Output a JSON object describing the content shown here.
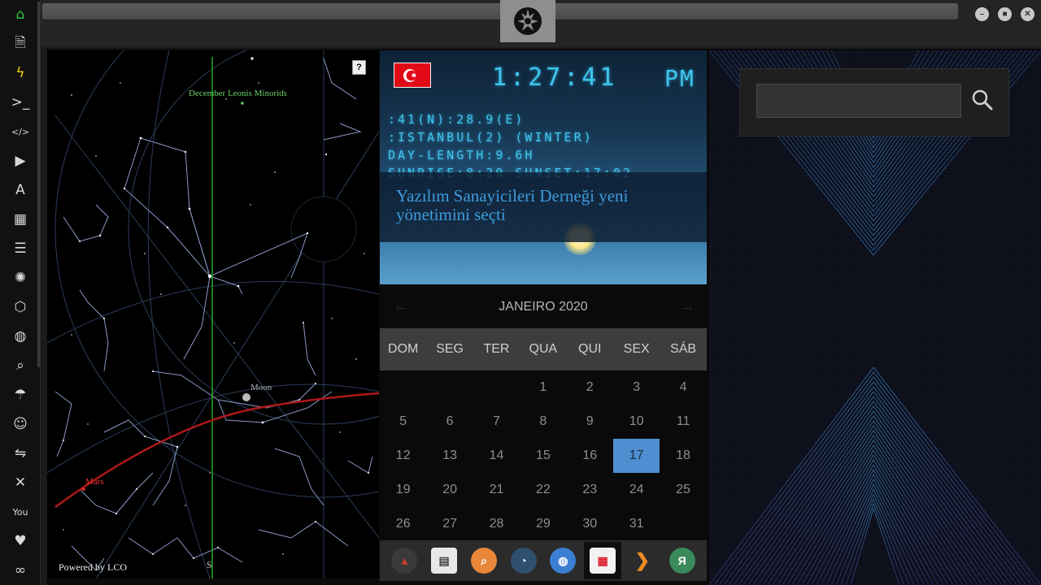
{
  "window": {
    "controls": [
      {
        "name": "minimize",
        "glyph": "–"
      },
      {
        "name": "maximize",
        "glyph": "■"
      },
      {
        "name": "close",
        "glyph": "✕"
      }
    ]
  },
  "sidebar": {
    "items": [
      {
        "icon": "home-icon",
        "glyph": "⌂"
      },
      {
        "icon": "document-icon",
        "glyph": "🗎"
      },
      {
        "icon": "bolt-icon",
        "glyph": "ϟ"
      },
      {
        "icon": "terminal-icon",
        "glyph": ">_"
      },
      {
        "icon": "code-icon",
        "glyph": "</>"
      },
      {
        "icon": "play-icon",
        "glyph": "▶"
      },
      {
        "icon": "translate-icon",
        "glyph": "A"
      },
      {
        "icon": "image-icon",
        "glyph": "▦"
      },
      {
        "icon": "newspaper-icon",
        "glyph": "☰"
      },
      {
        "icon": "rebel-icon",
        "glyph": "✺"
      },
      {
        "icon": "hexagon-icon",
        "glyph": "⬡"
      },
      {
        "icon": "globe-icon",
        "glyph": "◍"
      },
      {
        "icon": "search-icon",
        "glyph": "⌕"
      },
      {
        "icon": "umbrella-icon",
        "glyph": "☂"
      },
      {
        "icon": "contact-icon",
        "glyph": "☺"
      },
      {
        "icon": "transfer-icon",
        "glyph": "⇋"
      },
      {
        "icon": "expand-icon",
        "glyph": "✕"
      },
      {
        "icon": "youtube-icon",
        "glyph": "You"
      },
      {
        "icon": "heart-icon",
        "glyph": "♥"
      },
      {
        "icon": "infinity-icon",
        "glyph": "∞"
      }
    ]
  },
  "skymap": {
    "help_label": "?",
    "meteor_label": "December Leonis Minorids",
    "moon_label": "Moon",
    "mars_label": "Mars",
    "powered_by": "Powered by LCO",
    "compass_label": "S"
  },
  "clock": {
    "time": "1:27:41",
    "ampm": "PM",
    "coords": ":41(N):28.9(E)",
    "location": ":ISTANBUL(2) (WINTER)",
    "day_length": "DAY-LENGTH:9.6H",
    "sun_times": "SUNRISE:8:29 SUNSET:17:02",
    "headline": "Yazılım Sanayicileri Derneği yeni yönetimini seçti",
    "colors": {
      "digital": "#3ec5ef",
      "flag": "#e30a17"
    }
  },
  "calendar": {
    "month_label": "JANEIRO 2020",
    "prev_glyph": "←",
    "next_glyph": "→",
    "weekdays": [
      "DOM",
      "SEG",
      "TER",
      "QUA",
      "QUI",
      "SEX",
      "SÁB"
    ],
    "weeks": [
      [
        "",
        "",
        "",
        "1",
        "2",
        "3",
        "4"
      ],
      [
        "5",
        "6",
        "7",
        "8",
        "9",
        "10",
        "11"
      ],
      [
        "12",
        "13",
        "14",
        "15",
        "16",
        "17",
        "18"
      ],
      [
        "19",
        "20",
        "21",
        "22",
        "23",
        "24",
        "25"
      ],
      [
        "26",
        "27",
        "28",
        "29",
        "30",
        "31",
        ""
      ]
    ],
    "selected_day": "17",
    "colors": {
      "selected": "#4f8ed0"
    }
  },
  "dock": {
    "items": [
      {
        "icon": "alpha-app-icon",
        "glyph": "▲",
        "color": "#c0392b",
        "bg": "#3a3a3a"
      },
      {
        "icon": "news-icon",
        "glyph": "▤",
        "color": "#444",
        "bg": "#e8e8e8"
      },
      {
        "icon": "search-app-icon",
        "glyph": "⌕",
        "color": "#fff",
        "bg": "#e8873a"
      },
      {
        "icon": "clock-icon",
        "glyph": "◔",
        "color": "#fff",
        "bg": "#2f4f6f"
      },
      {
        "icon": "globe-app-icon",
        "glyph": "◍",
        "color": "#fff",
        "bg": "#3b7fd3"
      },
      {
        "icon": "calendar-icon",
        "glyph": "▦",
        "color": "#d23",
        "bg": "#f2f2f2"
      },
      {
        "icon": "forward-icon",
        "glyph": "❯",
        "color": "#f08a20",
        "bg": "transparent"
      },
      {
        "icon": "yandex-icon",
        "glyph": "Я",
        "color": "#fff",
        "bg": "#3a8a5c"
      }
    ],
    "active_index": 5
  },
  "search": {
    "value": ""
  }
}
